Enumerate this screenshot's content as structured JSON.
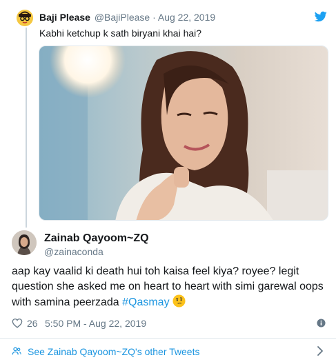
{
  "quoted_tweet": {
    "author_name": "Baji Please",
    "meta": "@BajiPlease · Aug 22, 2019",
    "text": "Kabhi ketchup k sath biryani khai hai?"
  },
  "tweet": {
    "author_name": "Zainab Qayoom~ZQ",
    "handle": "@zainaconda",
    "text": "aap kay vaalid ki death hui toh kaisa feel kiya? royee? legit question she asked me on heart to heart with simi garewal oops with samina peerzada ",
    "hashtag": "#Qasmay",
    "likes": "26",
    "timestamp": "5:50 PM - Aug 22, 2019"
  },
  "footer": {
    "link_text": "See Zainab Qayoom~ZQ's other Tweets"
  },
  "colors": {
    "link": "#1b95e0",
    "muted": "#657786",
    "text": "#14171a",
    "border": "#e1e8ed"
  },
  "icons": [
    "twitter-bird-icon",
    "heart-icon",
    "info-icon",
    "people-icon",
    "chevron-right-icon",
    "thinking-face-emoji"
  ]
}
